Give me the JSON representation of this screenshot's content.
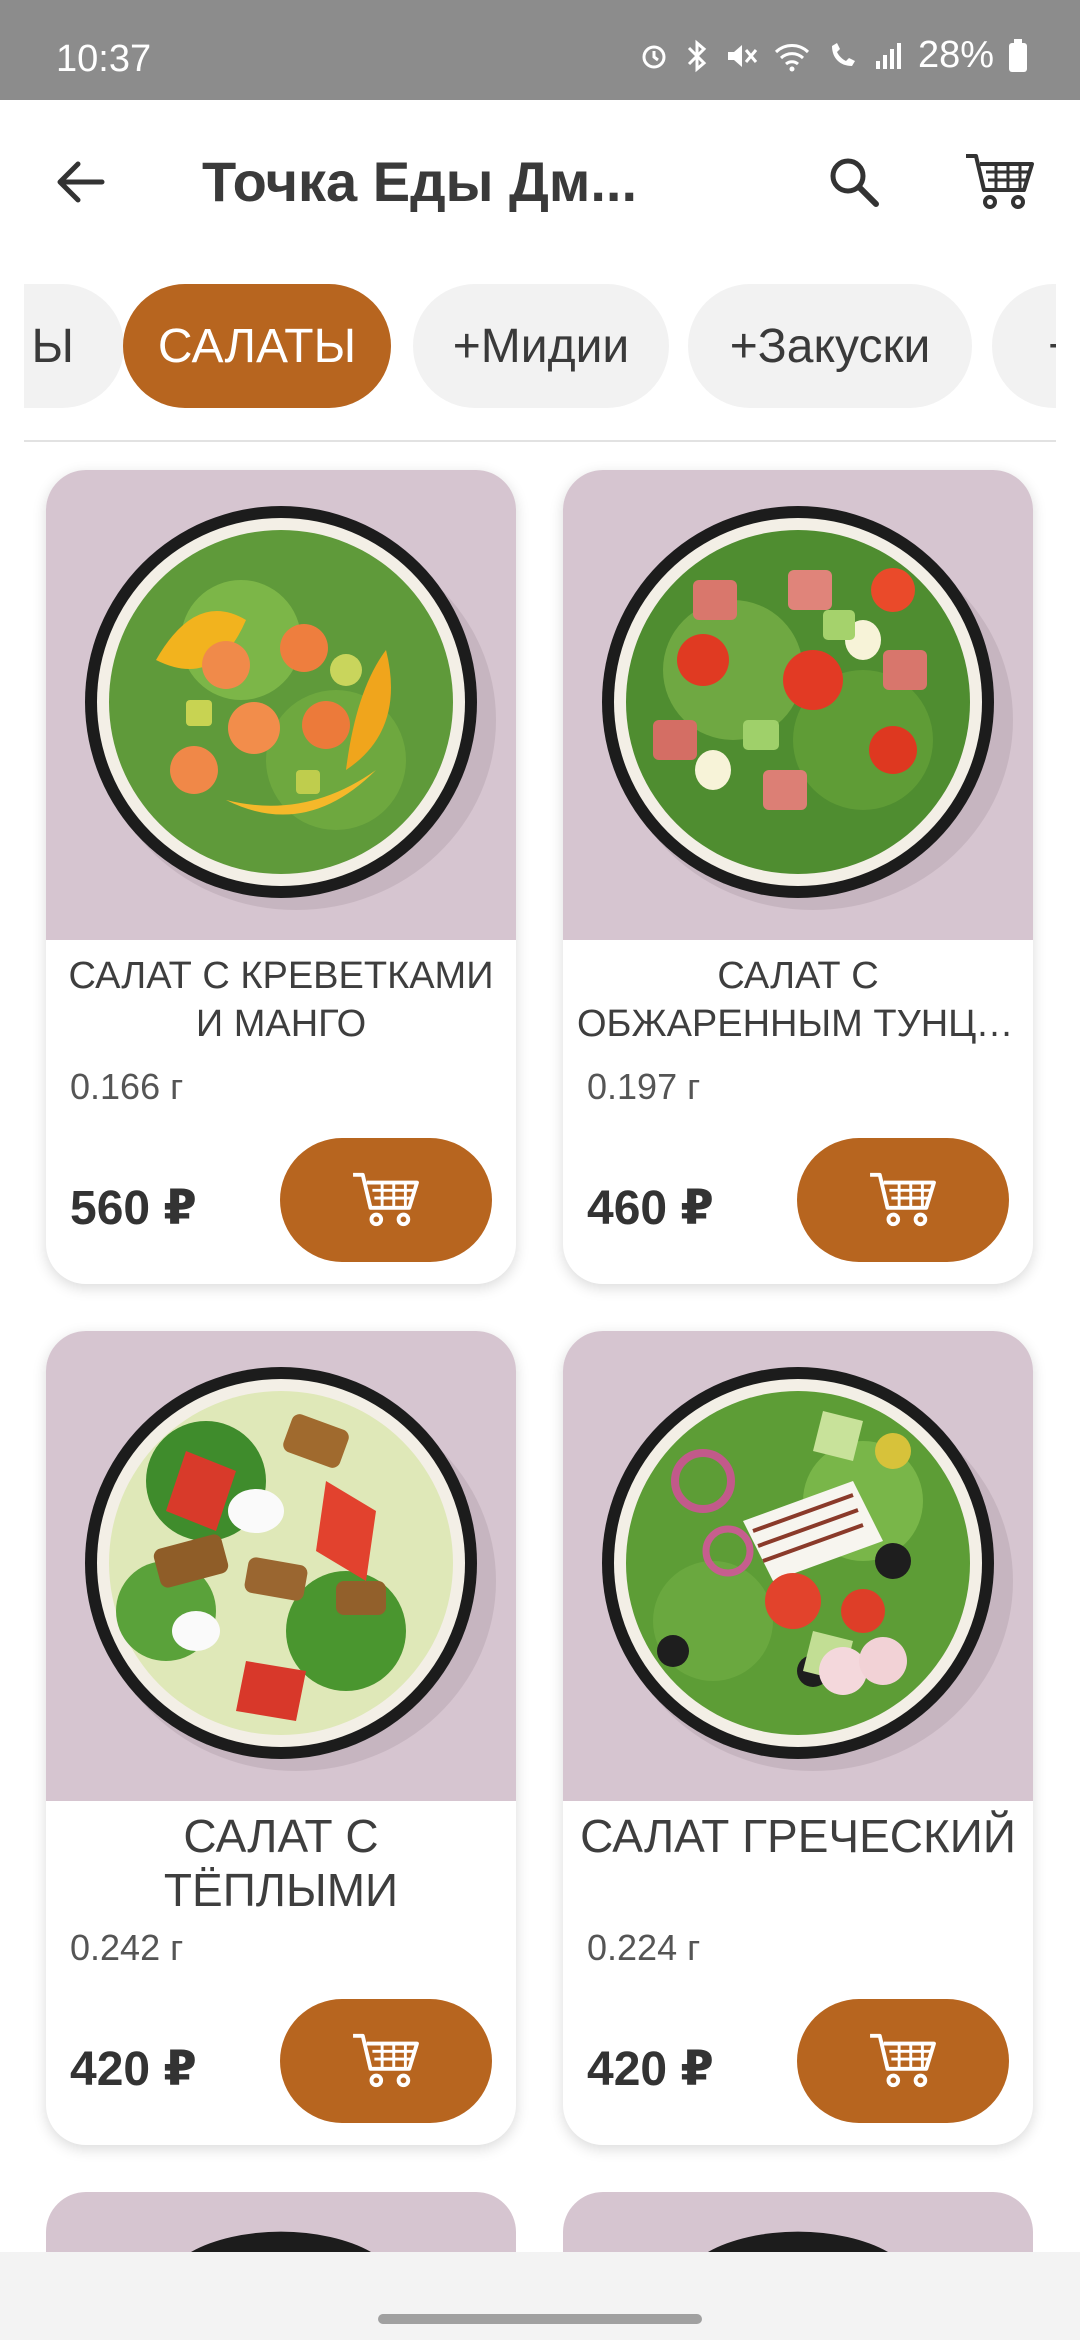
{
  "status_bar": {
    "time": "10:37",
    "battery": "28%",
    "icons": [
      "alarm-icon",
      "bluetooth-icon",
      "mute-icon",
      "wifi-icon",
      "wifi-call-icon",
      "signal-icon",
      "battery-icon"
    ]
  },
  "header": {
    "title": "Точка Еды Дм...",
    "back_icon": "arrow-left-icon",
    "search_icon": "search-icon",
    "cart_icon": "cart-icon"
  },
  "categories": {
    "items": [
      {
        "label": "Ы",
        "active": false
      },
      {
        "label": "САЛАТЫ",
        "active": true
      },
      {
        "label": "+Мидии",
        "active": false
      },
      {
        "label": "+Закуски",
        "active": false
      },
      {
        "label": "+",
        "active": false
      }
    ]
  },
  "products": [
    {
      "name": "САЛАТ С КРЕВЕТКАМИ И МАНГО",
      "weight": "0.166 г",
      "price": "560 ₽"
    },
    {
      "name_line1": "САЛАТ С",
      "name_line2": "ОБЖАРЕННЫМ ТУНЦО...",
      "weight": "0.197 г",
      "price": "460 ₽"
    },
    {
      "name": "САЛАТ С ТЁПЛЫМИ БАКЛАЖАНАМИ",
      "weight": "0.242 г",
      "price": "420 ₽"
    },
    {
      "name": "САЛАТ ГРЕЧЕСКИЙ",
      "weight": "0.224 г",
      "price": "420 ₽"
    }
  ],
  "colors": {
    "accent": "#b7651f",
    "photo_bg": "#d6c5d0",
    "status_bar": "#8c8c8c",
    "chip_bg": "#f2f2f2"
  }
}
